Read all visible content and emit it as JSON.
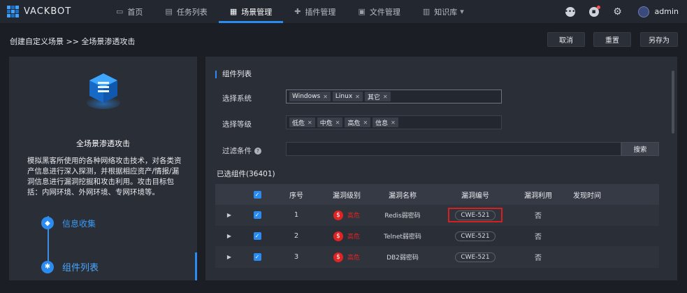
{
  "app": {
    "brand": "VACKBOT",
    "nav": [
      {
        "label": "首页",
        "icon": "monitor-icon"
      },
      {
        "label": "任务列表",
        "icon": "clipboard-icon"
      },
      {
        "label": "场景管理",
        "icon": "grid-icon"
      },
      {
        "label": "插件管理",
        "icon": "puzzle-icon"
      },
      {
        "label": "文件管理",
        "icon": "folder-icon"
      },
      {
        "label": "知识库",
        "icon": "book-icon"
      }
    ],
    "active_nav": "场景管理",
    "user": "admin",
    "accent": "#2a8cf0"
  },
  "header": {
    "breadcrumb": "创建自定义场景 >> 全场景渗透攻击",
    "cancel_label": "取消",
    "reset_label": "重置",
    "save_as_label": "另存为"
  },
  "scene": {
    "title": "全场景渗透攻击",
    "description": "模拟黑客所使用的各种网络攻击技术，对各类资产信息进行深入探测，并根据相应资产/情报/漏洞信息进行漏洞挖掘和攻击利用。攻击目标包括：内网环境、外网环境、专网环境等。",
    "steps": [
      {
        "label": "信息收集"
      },
      {
        "label": "组件列表"
      }
    ]
  },
  "components": {
    "section_title": "组件列表",
    "system_label": "选择系统",
    "systems": [
      "Windows",
      "Linux",
      "其它"
    ],
    "level_label": "选择等级",
    "levels": [
      "低危",
      "中危",
      "高危",
      "信息"
    ],
    "filter_label": "过滤条件",
    "filter_value": "",
    "search_label": "搜索",
    "selected_count": "已选组件(36401)",
    "columns": [
      "序号",
      "漏洞级别",
      "漏洞名称",
      "漏洞编号",
      "漏洞利用",
      "发现时间"
    ],
    "rows": [
      {
        "no": "1",
        "level": "高危",
        "name": "Redis弱密码",
        "cwe": "CWE-521",
        "exploit": "否",
        "time": "",
        "highlight": true
      },
      {
        "no": "2",
        "level": "高危",
        "name": "Telnet弱密码",
        "cwe": "CWE-521",
        "exploit": "否",
        "time": "",
        "highlight": false
      },
      {
        "no": "3",
        "level": "高危",
        "name": "DB2弱密码",
        "cwe": "CWE-521",
        "exploit": "否",
        "time": "",
        "highlight": false
      }
    ],
    "high_color": "#e02424"
  }
}
